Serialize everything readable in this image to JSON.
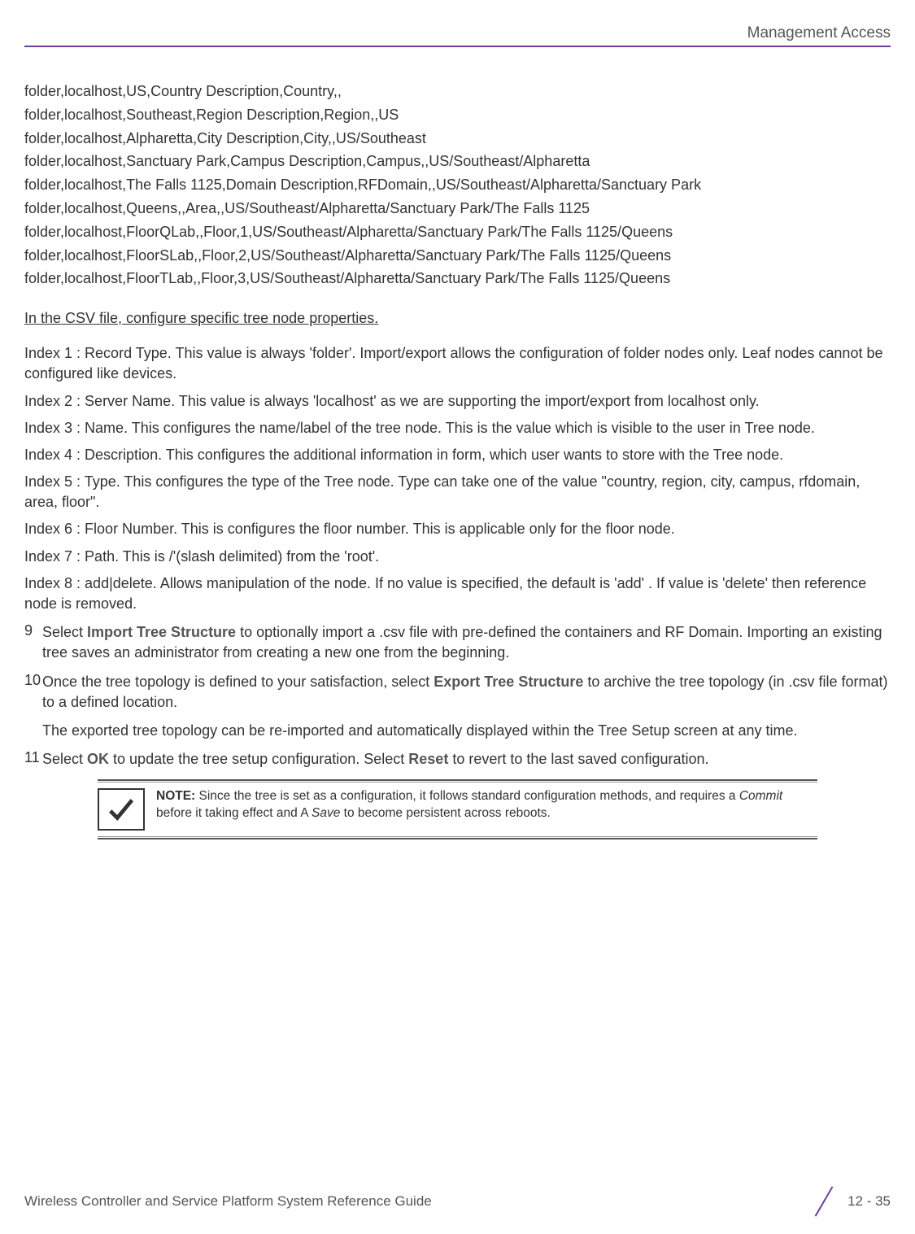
{
  "header": {
    "title": "Management Access"
  },
  "csv": {
    "lines": [
      "folder,localhost,US,Country Description,Country,,",
      "folder,localhost,Southeast,Region Description,Region,,US",
      "folder,localhost,Alpharetta,City Description,City,,US/Southeast",
      "folder,localhost,Sanctuary Park,Campus Description,Campus,,US/Southeast/Alpharetta",
      "folder,localhost,The Falls 1125,Domain Description,RFDomain,,US/Southeast/Alpharetta/Sanctuary Park",
      "folder,localhost,Queens,,Area,,US/Southeast/Alpharetta/Sanctuary Park/The Falls 1125",
      "folder,localhost,FloorQLab,,Floor,1,US/Southeast/Alpharetta/Sanctuary Park/The Falls 1125/Queens",
      "folder,localhost,FloorSLab,,Floor,2,US/Southeast/Alpharetta/Sanctuary Park/The Falls 1125/Queens",
      "folder,localhost,FloorTLab,,Floor,3,US/Southeast/Alpharetta/Sanctuary Park/The Falls 1125/Queens"
    ]
  },
  "section_heading": "In the CSV file, configure specific tree node properties.",
  "indexes": [
    "Index 1 : Record Type. This value is always 'folder'. Import/export allows the configuration of folder nodes only. Leaf nodes cannot be configured like devices.",
    "Index 2 : Server Name. This value is always 'localhost' as we are supporting the import/export from localhost only.",
    "Index 3 : Name. This configures the name/label of the tree node. This is the value which is visible to the user in Tree node.",
    "Index 4 : Description. This configures the additional information in form, which user wants to store with the Tree node.",
    "Index 5 : Type. This configures the type of the Tree node. Type can take one of the value \"country, region, city, campus, rfdomain, area, floor\".",
    "Index 6 : Floor Number. This is configures the floor number. This is applicable only for the floor node.",
    "Index 7 : Path. This is /'(slash delimited) from the 'root'.",
    "Index 8 : add|delete. Allows manipulation of the node. If no value is specified, the default is 'add' . If value is 'delete' then reference node is removed."
  ],
  "steps": {
    "s9": {
      "number": "9",
      "pre": "Select ",
      "bold": "Import Tree Structure",
      "post": " to optionally import a .csv file with pre-defined the containers and RF Domain. Importing an existing tree saves an administrator from creating a new one from the beginning."
    },
    "s10": {
      "number": "10",
      "pre": "Once the tree topology is defined to your satisfaction, select ",
      "bold": "Export Tree Structure",
      "post": " to archive the tree topology (in .csv file format) to a defined location.",
      "extra": "The exported tree topology can be re-imported and automatically displayed within the Tree Setup screen at any time."
    },
    "s11": {
      "number": "11",
      "pre1": "Select ",
      "bold1": "OK",
      "mid": " to update the tree setup configuration. Select ",
      "bold2": "Reset",
      "post": " to revert to the last saved configuration."
    }
  },
  "note": {
    "label": "NOTE:",
    "pre": " Since the tree is set as a configuration, it follows standard configuration methods, and requires a ",
    "em1": "Commit",
    "mid": " before it taking effect and A ",
    "em2": "Save",
    "post": " to become persistent across reboots."
  },
  "footer": {
    "left": "Wireless Controller and Service Platform System Reference Guide",
    "page": "12 - 35"
  }
}
